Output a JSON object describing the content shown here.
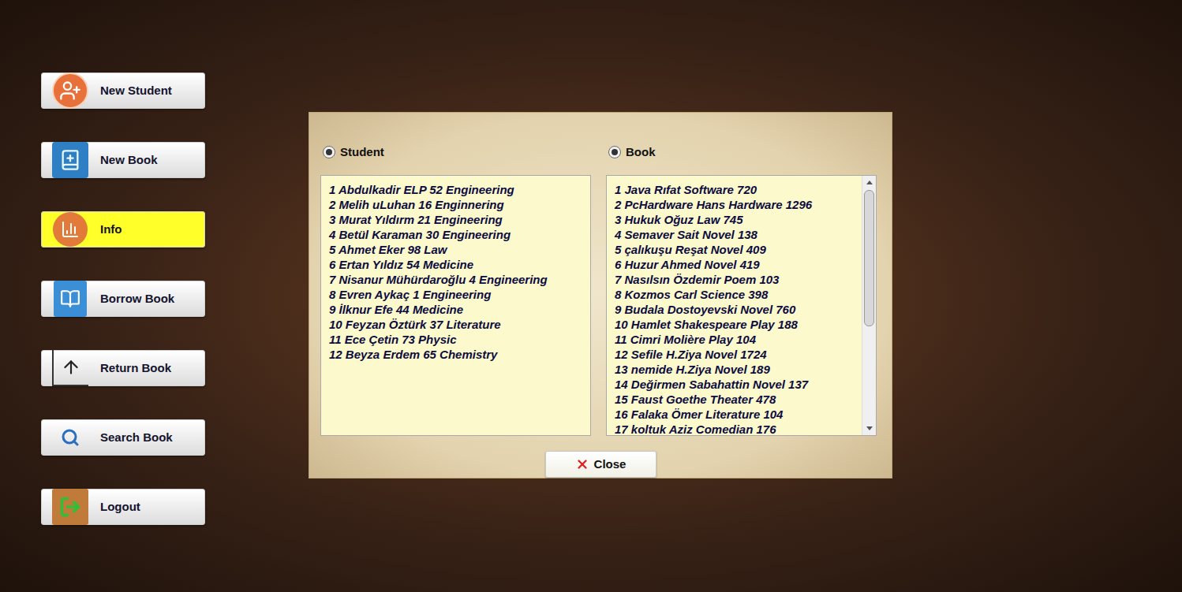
{
  "sidebar": {
    "items": [
      {
        "label": "New Student",
        "selected": false,
        "kind": "student"
      },
      {
        "label": "New Book",
        "selected": false,
        "kind": "book"
      },
      {
        "label": "Info",
        "selected": true,
        "kind": "info"
      },
      {
        "label": "Borrow Book",
        "selected": false,
        "kind": "borrow"
      },
      {
        "label": "Return Book",
        "selected": false,
        "kind": "return"
      },
      {
        "label": "Search Book",
        "selected": false,
        "kind": "search"
      },
      {
        "label": "Logout",
        "selected": false,
        "kind": "logout"
      }
    ]
  },
  "dialog": {
    "panels": [
      {
        "label": "Student",
        "selected": true,
        "scrollbar": false,
        "rows": [
          "1 Abdulkadir ELP 52 Engineering",
          "2 Melih uLuhan 16 Enginnering",
          "3 Murat Yıldırm 21 Engineering",
          "4 Betül Karaman 30 Engineering",
          "5 Ahmet Eker 98 Law",
          "6 Ertan Yıldız 54 Medicine",
          "7 Nisanur Mühürdaroğlu 4 Engineering",
          "8 Evren Aykaç 1 Engineering",
          "9 İlknur Efe 44 Medicine",
          "10 Feyzan Öztürk 37 Literature",
          "11 Ece Çetin 73 Physic",
          "12 Beyza Erdem 65 Chemistry"
        ]
      },
      {
        "label": "Book",
        "selected": true,
        "scrollbar": true,
        "level": 0.59,
        "rows": [
          "1 Java Rıfat Software 720",
          "2 PcHardware Hans Hardware 1296",
          "3 Hukuk Oğuz Law 745",
          "4 Semaver Sait Novel 138",
          "5 çalıkuşu Reşat Novel 409",
          "6 Huzur Ahmed Novel 419",
          "7 Nasılsın Özdemir Poem 103",
          "8 Kozmos Carl Science 398",
          "9 Budala Dostoyevski Novel 760",
          "10 Hamlet Shakespeare Play 188",
          "11 Cimri Molière Play 104",
          "12 Sefile H.Ziya Novel 1724",
          "13 nemide H.Ziya Novel 189",
          "14 Değirmen Sabahattin Novel 137",
          "15 Faust Goethe Theater 478",
          "16 Falaka Ömer Literature 104",
          "17 koltuk Aziz Comedian 176"
        ]
      }
    ],
    "close_button": "Close"
  }
}
